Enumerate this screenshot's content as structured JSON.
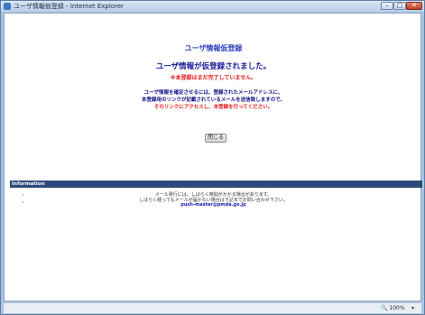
{
  "window": {
    "title": "ユーザ情報仮登録 - Internet Explorer",
    "min_glyph": "–",
    "max_glyph": "□",
    "close_glyph": "✕"
  },
  "page": {
    "title": "ユーザ情報仮登録",
    "heading": "ユーザ情報が仮登録されました。",
    "warning": "※本登録はまだ完了していません。",
    "message_lines": [
      "ユーザ情報を確定させるには、登録されたメールアドレスに、",
      "本登録用のリンクが記載されているメールを送信致しますので、",
      "そのリンクにアクセスし、本登録を行ってください。"
    ],
    "close_button_label": "閉じる"
  },
  "information": {
    "label": "Information",
    "lines": [
      "メール発行には、しばらく時間がかかる場合があります。",
      "しばらく経ってもメールが届かない場合は下記までお問い合わせ下さい。"
    ],
    "email": "push-master@pmda.go.jp",
    "bullet": "・"
  },
  "status_bar": {
    "zoom": "100%",
    "zoom_icon": "🔍",
    "dropdown_glyph": "▾"
  },
  "colors": {
    "title_blue": "#2a3fbf",
    "warning_red": "#e61d1d",
    "info_bar": "#2d4a7a"
  }
}
